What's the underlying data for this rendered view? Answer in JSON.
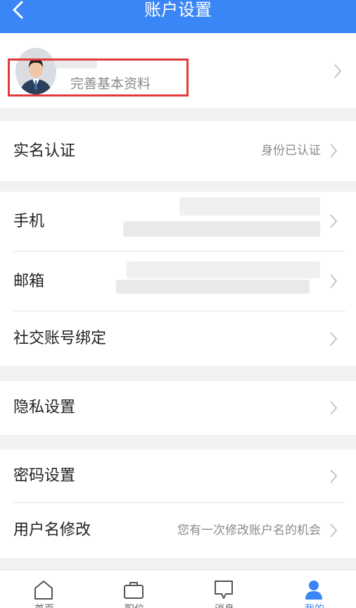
{
  "header": {
    "title": "账户设置"
  },
  "profile": {
    "subtitle": "完善基本资料"
  },
  "rows": {
    "realname": {
      "label": "实名认证",
      "value": "身份已认证"
    },
    "phone": {
      "label": "手机",
      "value": ""
    },
    "email": {
      "label": "邮箱",
      "value": ""
    },
    "social": {
      "label": "社交账号绑定"
    },
    "privacy": {
      "label": "隐私设置"
    },
    "password": {
      "label": "密码设置"
    },
    "username": {
      "label": "用户名修改",
      "value": "您有一次修改账户名的机会"
    }
  },
  "tabs": [
    {
      "label": "首页",
      "icon": "home-icon"
    },
    {
      "label": "职位",
      "icon": "briefcase-icon"
    },
    {
      "label": "消息",
      "icon": "message-icon"
    },
    {
      "label": "我的",
      "icon": "user-icon"
    }
  ],
  "colors": {
    "header": "#3a86f6",
    "highlight": "#e03a3a",
    "active_tab": "#3a86f6"
  }
}
